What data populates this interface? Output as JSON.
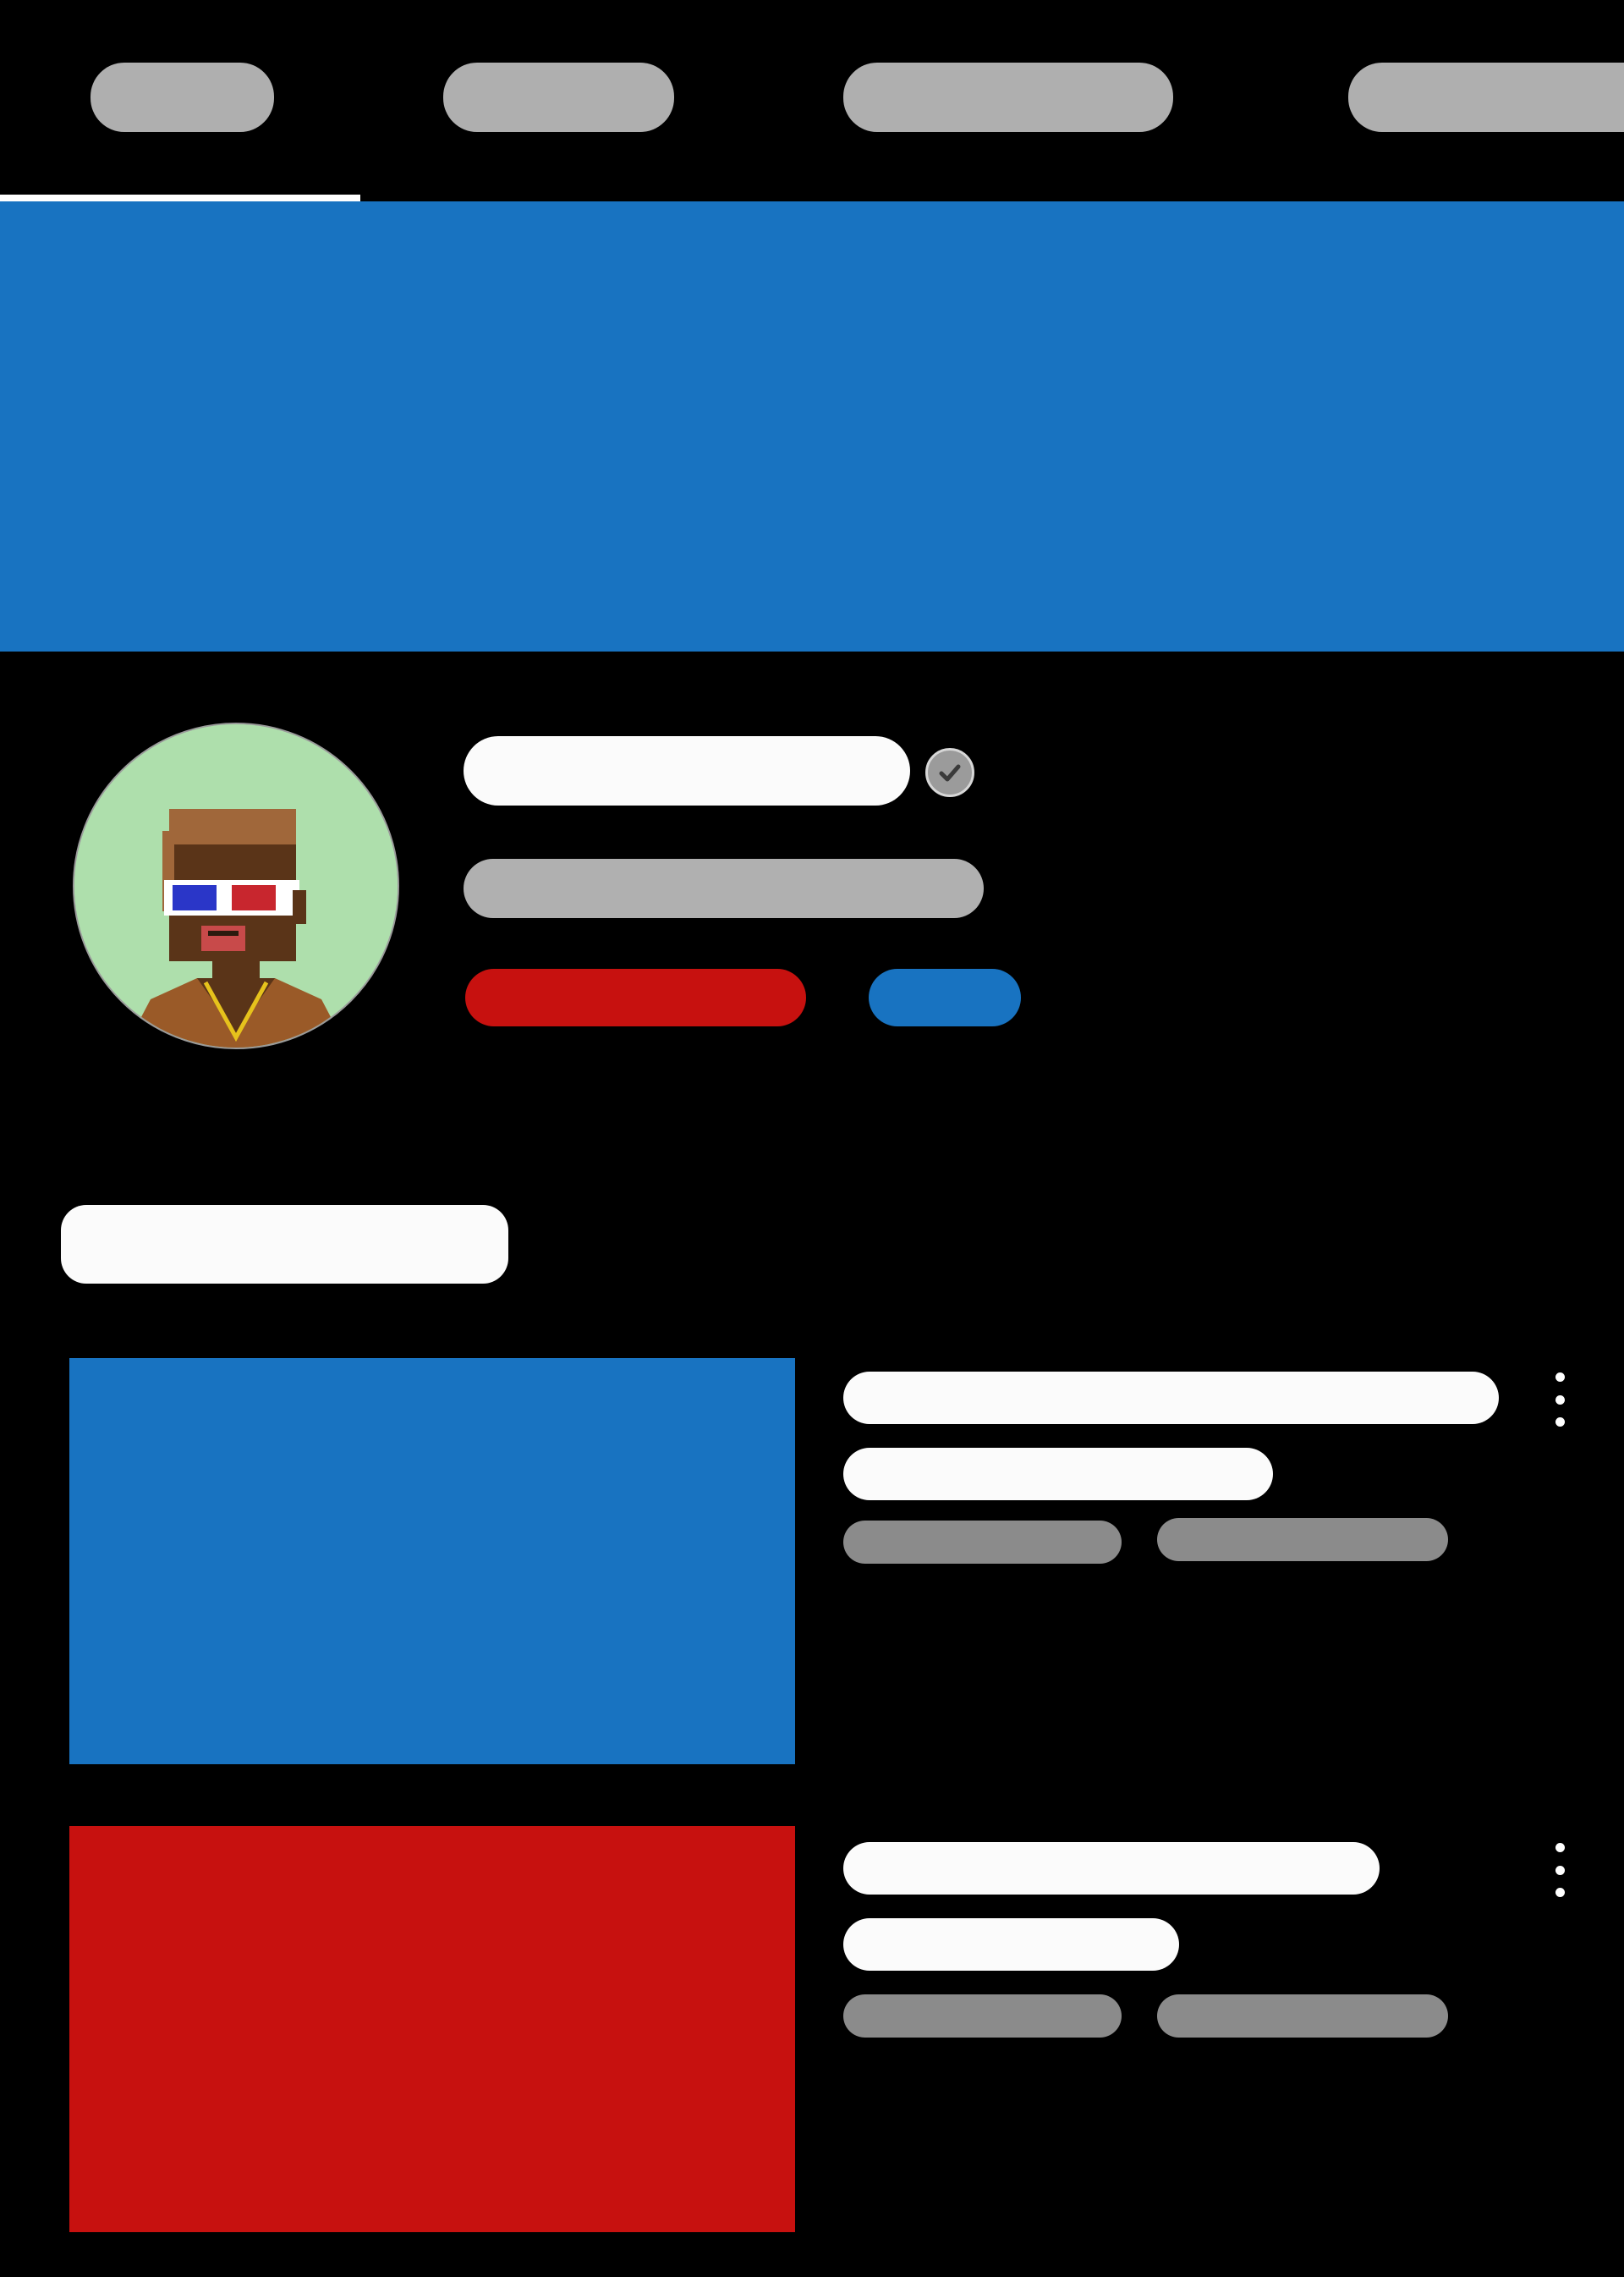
{
  "tabs": [
    {
      "label": ""
    },
    {
      "label": ""
    },
    {
      "label": ""
    },
    {
      "label": ""
    }
  ],
  "active_tab_index": 0,
  "colors": {
    "background": "#000000",
    "accent_blue": "#1873c1",
    "accent_red": "#c7110f",
    "placeholder_white": "#fbfbfb",
    "placeholder_grey": "#b0b0b0",
    "placeholder_dark_grey": "#8b8b8b",
    "avatar_bg": "#aedfac"
  },
  "channel": {
    "name": "",
    "handle": "",
    "verified_icon": "check-circle-icon",
    "primary_action_label": "",
    "secondary_action_label": ""
  },
  "section": {
    "title": ""
  },
  "videos": [
    {
      "title_line1": "",
      "title_line2": "",
      "views": "",
      "age": "",
      "thumbnail_color": "#1873c1",
      "menu_icon": "more-vertical-icon"
    },
    {
      "title_line1": "",
      "title_line2": "",
      "views": "",
      "age": "",
      "thumbnail_color": "#c7110f",
      "menu_icon": "more-vertical-icon"
    }
  ]
}
